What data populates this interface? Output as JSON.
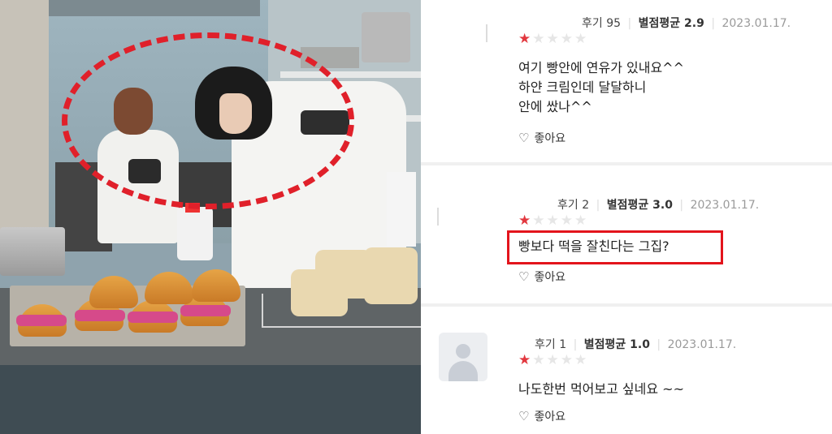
{
  "reviews": [
    {
      "review_count": "후기 95",
      "avg_rating": "별점평균 2.9",
      "date": "2023.01.17.",
      "stars": {
        "filled": 1,
        "total": 5
      },
      "text": "여기 빵안에 연유가 있내요^^\n하얀 크림인데 달달하니\n안에 쌌나^^",
      "like_label": "좋아요",
      "has_avatar": false,
      "highlighted": false
    },
    {
      "review_count": "후기 2",
      "avg_rating": "별점평균 3.0",
      "date": "2023.01.17.",
      "stars": {
        "filled": 1,
        "total": 5
      },
      "text": "빵보다 떡을 잘친다는 그집?",
      "like_label": "좋아요",
      "has_avatar": false,
      "highlighted": true
    },
    {
      "review_count": "후기 1",
      "avg_rating": "별점평균 1.0",
      "date": "2023.01.17.",
      "stars": {
        "filled": 1,
        "total": 5
      },
      "text": "나도한번 먹어보고 싶네요 ~~",
      "like_label": "좋아요",
      "has_avatar": true,
      "highlighted": false
    }
  ],
  "icons": {
    "star": "star-icon",
    "heart": "heart-outline-icon",
    "avatar": "default-user-avatar-icon"
  },
  "colors": {
    "star_filled": "#e2383f",
    "star_empty": "#e6e6e6",
    "highlight_box": "#e3141c",
    "photo_annotation": "#e0202a"
  }
}
